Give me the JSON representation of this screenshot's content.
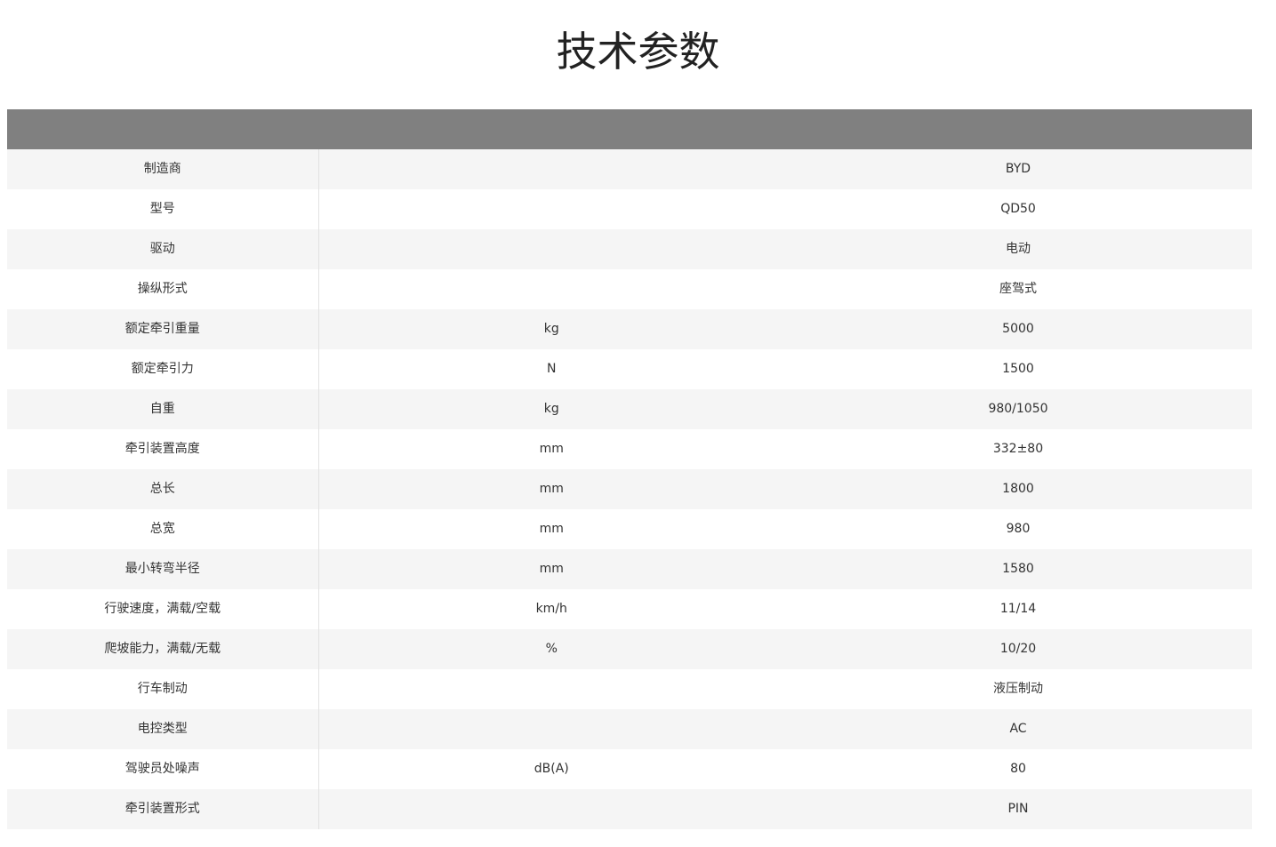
{
  "page": {
    "title": "技术参数"
  },
  "colors": {
    "title": "#222222",
    "text": "#333333",
    "header_bar": "#808080",
    "row_stripe": "#f5f5f5",
    "divider": "#e2e2e2"
  },
  "table": {
    "rows": [
      {
        "param": "制造商",
        "unit": "",
        "value": "BYD"
      },
      {
        "param": "型号",
        "unit": "",
        "value": "QD50"
      },
      {
        "param": "驱动",
        "unit": "",
        "value": "电动"
      },
      {
        "param": "操纵形式",
        "unit": "",
        "value": "座驾式"
      },
      {
        "param": "额定牵引重量",
        "unit": "kg",
        "value": "5000"
      },
      {
        "param": "额定牵引力",
        "unit": "N",
        "value": "1500"
      },
      {
        "param": "自重",
        "unit": "kg",
        "value": "980/1050"
      },
      {
        "param": "牵引装置高度",
        "unit": "mm",
        "value": "332±80"
      },
      {
        "param": "总长",
        "unit": "mm",
        "value": "1800"
      },
      {
        "param": "总宽",
        "unit": "mm",
        "value": "980"
      },
      {
        "param": "最小转弯半径",
        "unit": "mm",
        "value": "1580"
      },
      {
        "param": "行驶速度，满载/空载",
        "unit": "km/h",
        "value": "11/14"
      },
      {
        "param": "爬坡能力，满载/无载",
        "unit": "%",
        "value": "10/20"
      },
      {
        "param": "行车制动",
        "unit": "",
        "value": "液压制动"
      },
      {
        "param": "电控类型",
        "unit": "",
        "value": "AC"
      },
      {
        "param": "驾驶员处噪声",
        "unit": "dB(A)",
        "value": "80"
      },
      {
        "param": "牵引装置形式",
        "unit": "",
        "value": "PIN"
      }
    ]
  }
}
